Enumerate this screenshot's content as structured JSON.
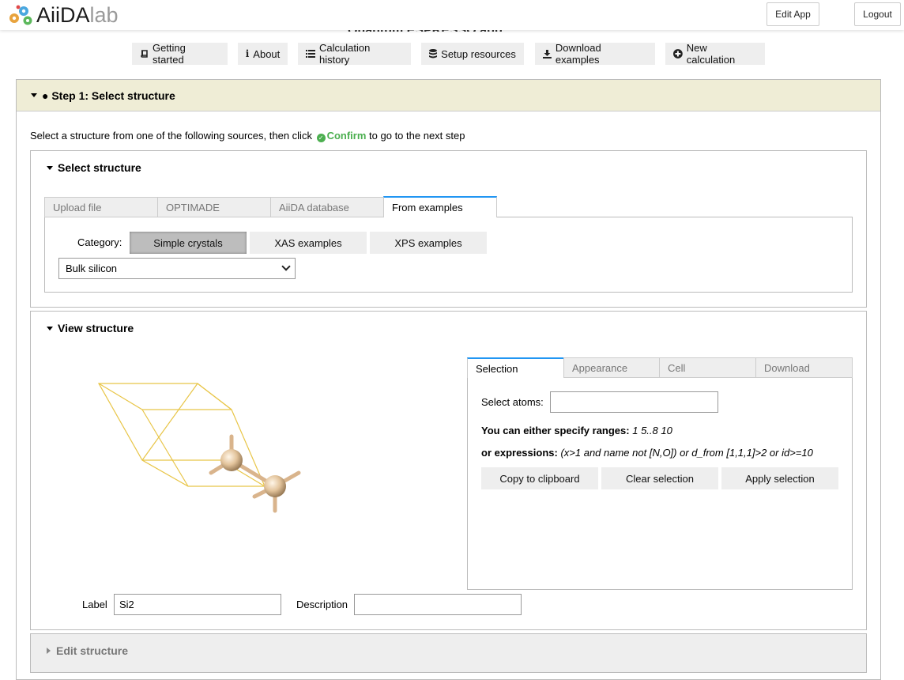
{
  "app": {
    "logo_main": "AiiDA",
    "logo_sub": "lab",
    "page_heading": "Quantum ESPRESSO app",
    "edit_app_label": "Edit App",
    "logout_label": "Logout"
  },
  "nav": {
    "items": [
      {
        "label": "Getting started",
        "icon": "book-icon"
      },
      {
        "label": "About",
        "icon": "info-icon"
      },
      {
        "label": "Calculation history",
        "icon": "list-icon"
      },
      {
        "label": "Setup resources",
        "icon": "database-icon"
      },
      {
        "label": "Download examples",
        "icon": "download-icon"
      },
      {
        "label": "New calculation",
        "icon": "plus-circle-icon"
      }
    ]
  },
  "step1": {
    "title": "● Step 1: Select structure",
    "intro_before": "Select a structure from one of the following sources, then click",
    "confirm_word": "Confirm",
    "intro_after": "to go to the next step"
  },
  "select_structure": {
    "title": "Select structure",
    "tabs": [
      "Upload file",
      "OPTIMADE",
      "AiiDA database",
      "From examples"
    ],
    "active_tab": "From examples",
    "category_label": "Category:",
    "categories": [
      "Simple crystals",
      "XAS examples",
      "XPS examples"
    ],
    "active_category": "Simple crystals",
    "example_selected": "Bulk silicon"
  },
  "view_structure": {
    "title": "View structure",
    "tabs": [
      "Selection",
      "Appearance",
      "Cell",
      "Download"
    ],
    "active_tab": "Selection",
    "select_atoms_label": "Select atoms:",
    "select_atoms_value": "",
    "ranges_hint_bold": "You can either specify ranges:",
    "ranges_hint_example": "1 5..8 10",
    "expr_hint_bold": "or expressions:",
    "expr_hint_example": "(x>1 and name not [N,O]) or d_from [1,1,1]>2 or id>=10",
    "buttons": [
      "Copy to clipboard",
      "Clear selection",
      "Apply selection"
    ],
    "label_label": "Label",
    "label_value": "Si2",
    "description_label": "Description",
    "description_value": ""
  },
  "edit_structure": {
    "title": "Edit structure"
  },
  "colors": {
    "step_header_bg": "#efedd6",
    "confirm_green": "#4caf50",
    "tab_active_border": "#2196f3",
    "cell_line": "#e8c547",
    "atom": "#e3c49c"
  }
}
